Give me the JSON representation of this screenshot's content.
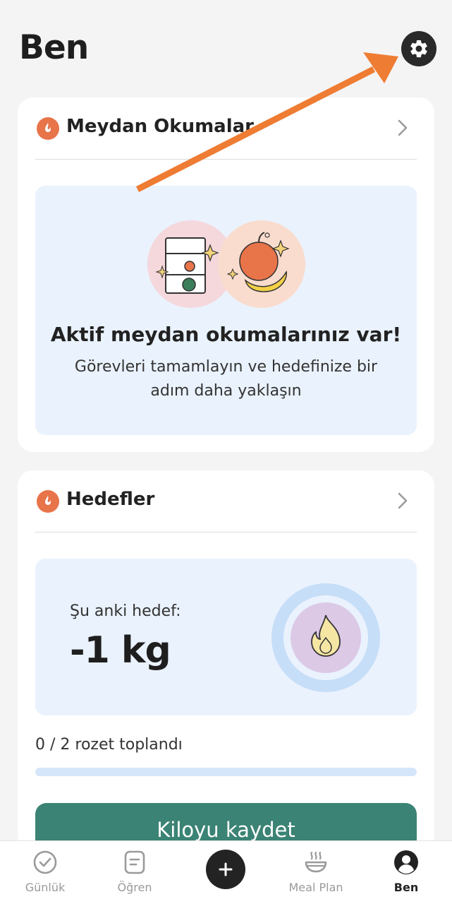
{
  "header": {
    "title": "Ben"
  },
  "challenges": {
    "title": "Meydan Okumalar",
    "heading": "Aktif meydan okumalarınız var!",
    "subtitle": "Görevleri tamamlayın ve hedefinize bir adım daha yaklaşın"
  },
  "goals": {
    "title": "Hedefler",
    "current_label": "Şu anki hedef:",
    "current_value": "-1 kg",
    "badges_text": "0 / 2 rozet toplandı",
    "badges_progress": 0,
    "save_button": "Kiloyu kaydet"
  },
  "tabs": [
    {
      "label": "Günlük",
      "icon": "check-circle-icon",
      "active": false
    },
    {
      "label": "Öğren",
      "icon": "notepad-icon",
      "active": false
    },
    {
      "label": "",
      "icon": "plus-icon",
      "active": false
    },
    {
      "label": "Meal Plan",
      "icon": "bowl-icon",
      "active": false
    },
    {
      "label": "Ben",
      "icon": "user-icon",
      "active": true
    }
  ],
  "colors": {
    "accent_orange": "#e8744a",
    "annotation_arrow": "#ef7c33",
    "primary_button": "#3b8374",
    "light_blue_panel": "#eaf2fd"
  }
}
